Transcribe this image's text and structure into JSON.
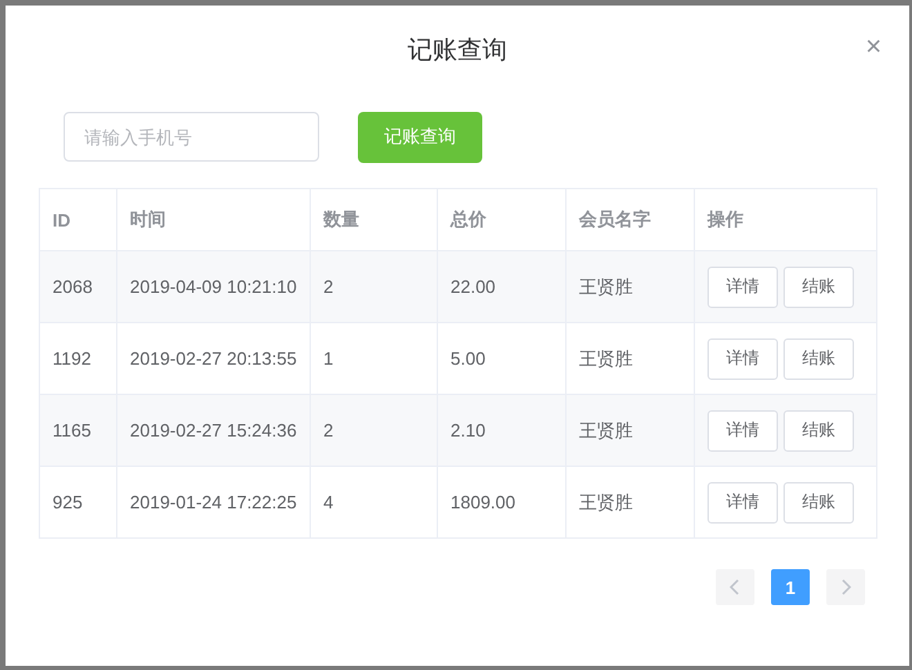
{
  "dialog": {
    "title": "记账查询",
    "close": "×"
  },
  "search": {
    "placeholder": "请输入手机号",
    "button": "记账查询"
  },
  "table": {
    "columns": [
      "ID",
      "时间",
      "数量",
      "总价",
      "会员名字",
      "操作"
    ],
    "rows": [
      {
        "cells": [
          "2068",
          "2019-04-09 10:21:10",
          "2",
          "22.00",
          "王贤胜"
        ],
        "actions": [
          "详情",
          "结账"
        ]
      },
      {
        "cells": [
          "1192",
          "2019-02-27 20:13:55",
          "1",
          "5.00",
          "王贤胜"
        ],
        "actions": [
          "详情",
          "结账"
        ]
      },
      {
        "cells": [
          "1165",
          "2019-02-27 15:24:36",
          "2",
          "2.10",
          "王贤胜"
        ],
        "actions": [
          "详情",
          "结账"
        ]
      },
      {
        "cells": [
          "925",
          "2019-01-24 17:22:25",
          "4",
          "1809.00",
          "王贤胜"
        ],
        "actions": [
          "详情",
          "结账"
        ]
      }
    ]
  },
  "pagination": {
    "pages": [
      {
        "label": "1",
        "selected": true
      }
    ],
    "prev_disabled": true,
    "next_disabled": true
  }
}
